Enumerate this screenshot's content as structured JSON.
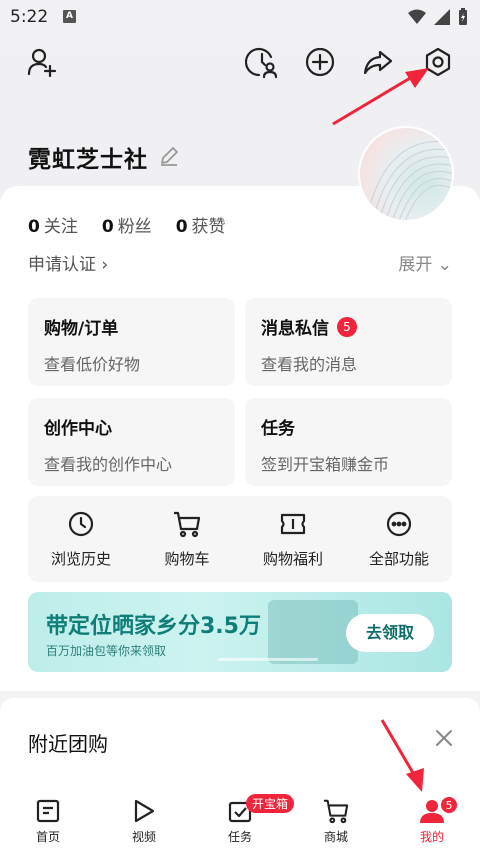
{
  "status_bar": {
    "time": "5:22",
    "a_label": "A"
  },
  "profile": {
    "name": "霓虹芝士社"
  },
  "stats": [
    {
      "num": "0",
      "label": "关注"
    },
    {
      "num": "0",
      "label": "粉丝"
    },
    {
      "num": "0",
      "label": "获赞"
    }
  ],
  "cert": {
    "label": "申请认证 ›"
  },
  "expand": {
    "label": "展开 ⌄"
  },
  "tiles": [
    {
      "title": "购物/订单",
      "sub": "查看低价好物"
    },
    {
      "title": "消息私信",
      "badge": "5",
      "sub": "查看我的消息"
    },
    {
      "title": "创作中心",
      "sub": "查看我的创作中心"
    },
    {
      "title": "任务",
      "sub": "签到开宝箱赚金币"
    }
  ],
  "quick": [
    {
      "label": "浏览历史",
      "icon": "clock-icon"
    },
    {
      "label": "购物车",
      "icon": "cart-icon"
    },
    {
      "label": "购物福利",
      "icon": "ticket-icon"
    },
    {
      "label": "全部功能",
      "icon": "more-icon"
    }
  ],
  "banner": {
    "title": "带定位晒家乡分3.5万",
    "sub": "百万加油包等你来领取",
    "button": "去领取"
  },
  "nearby": {
    "title": "附近团购"
  },
  "nav": [
    {
      "label": "首页"
    },
    {
      "label": "视频"
    },
    {
      "label": "任务",
      "pill": "开宝箱"
    },
    {
      "label": "商城"
    },
    {
      "label": "我的",
      "badge": "5"
    }
  ],
  "colors": {
    "accent": "#f0243a",
    "banner_text": "#0f7d78"
  }
}
